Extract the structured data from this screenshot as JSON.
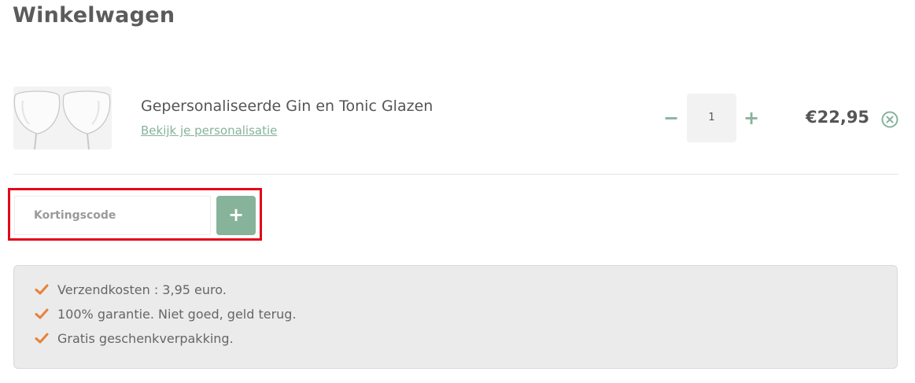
{
  "page_title": "Winkelwagen",
  "cart": {
    "item": {
      "image": "gin-tonic-glasses-image",
      "name": "Gepersonaliseerde Gin en Tonic Glazen",
      "link_label": "Bekijk je personalisatie",
      "quantity": "1",
      "price": "€22,95",
      "minus_label": "−",
      "plus_label": "+"
    }
  },
  "coupon": {
    "placeholder": "Kortingscode",
    "add_label": "+"
  },
  "info": {
    "items": [
      "Verzendkosten : 3,95 euro.",
      "100% garantie. Niet goed, geld terug.",
      "Gratis geschenkverpakking."
    ]
  },
  "colors": {
    "accent_green": "#86b39a",
    "check_orange": "#e8813a",
    "highlight_red": "#e3061a"
  }
}
